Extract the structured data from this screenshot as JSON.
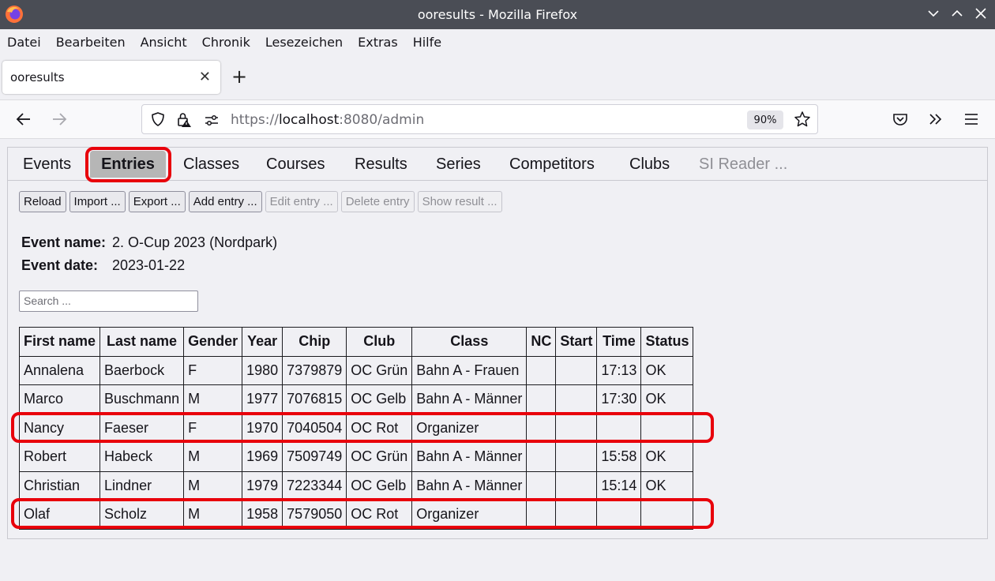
{
  "window": {
    "title": "ooresults - Mozilla Firefox"
  },
  "menu": [
    "Datei",
    "Bearbeiten",
    "Ansicht",
    "Chronik",
    "Lesezeichen",
    "Extras",
    "Hilfe"
  ],
  "browser_tab": {
    "title": "ooresults"
  },
  "address": {
    "scheme": "https://",
    "host": "localhost",
    "rest": ":8080/admin",
    "zoom": "90%"
  },
  "app_tabs": [
    "Events",
    "Entries",
    "Classes",
    "Courses",
    "Results",
    "Series",
    "Competitors",
    "Clubs",
    "SI Reader ..."
  ],
  "toolbar": {
    "reload": "Reload",
    "import": "Import ...",
    "export": "Export ...",
    "add": "Add entry ...",
    "edit": "Edit entry ...",
    "delete": "Delete entry",
    "show_result": "Show result ..."
  },
  "event": {
    "name_label": "Event name:",
    "name": "2. O-Cup 2023 (Nordpark)",
    "date_label": "Event date:",
    "date": "2023-01-22"
  },
  "search": {
    "placeholder": "Search ..."
  },
  "table": {
    "columns": [
      "First name",
      "Last name",
      "Gender",
      "Year",
      "Chip",
      "Club",
      "Class",
      "NC",
      "Start",
      "Time",
      "Status"
    ],
    "rows": [
      [
        "Annalena",
        "Baerbock",
        "F",
        "1980",
        "7379879",
        "OC Grün",
        "Bahn A - Frauen",
        "",
        "",
        "17:13",
        "OK"
      ],
      [
        "Marco",
        "Buschmann",
        "M",
        "1977",
        "7076815",
        "OC Gelb",
        "Bahn A - Männer",
        "",
        "",
        "17:30",
        "OK"
      ],
      [
        "Nancy",
        "Faeser",
        "F",
        "1970",
        "7040504",
        "OC Rot",
        "Organizer",
        "",
        "",
        "",
        ""
      ],
      [
        "Robert",
        "Habeck",
        "M",
        "1969",
        "7509749",
        "OC Grün",
        "Bahn A - Männer",
        "",
        "",
        "15:58",
        "OK"
      ],
      [
        "Christian",
        "Lindner",
        "M",
        "1979",
        "7223344",
        "OC Gelb",
        "Bahn A - Männer",
        "",
        "",
        "15:14",
        "OK"
      ],
      [
        "Olaf",
        "Scholz",
        "M",
        "1958",
        "7579050",
        "OC Rot",
        "Organizer",
        "",
        "",
        "",
        ""
      ]
    ]
  },
  "colors": {
    "highlight": "#e8000b",
    "active_tab": "#b6b6b6"
  }
}
